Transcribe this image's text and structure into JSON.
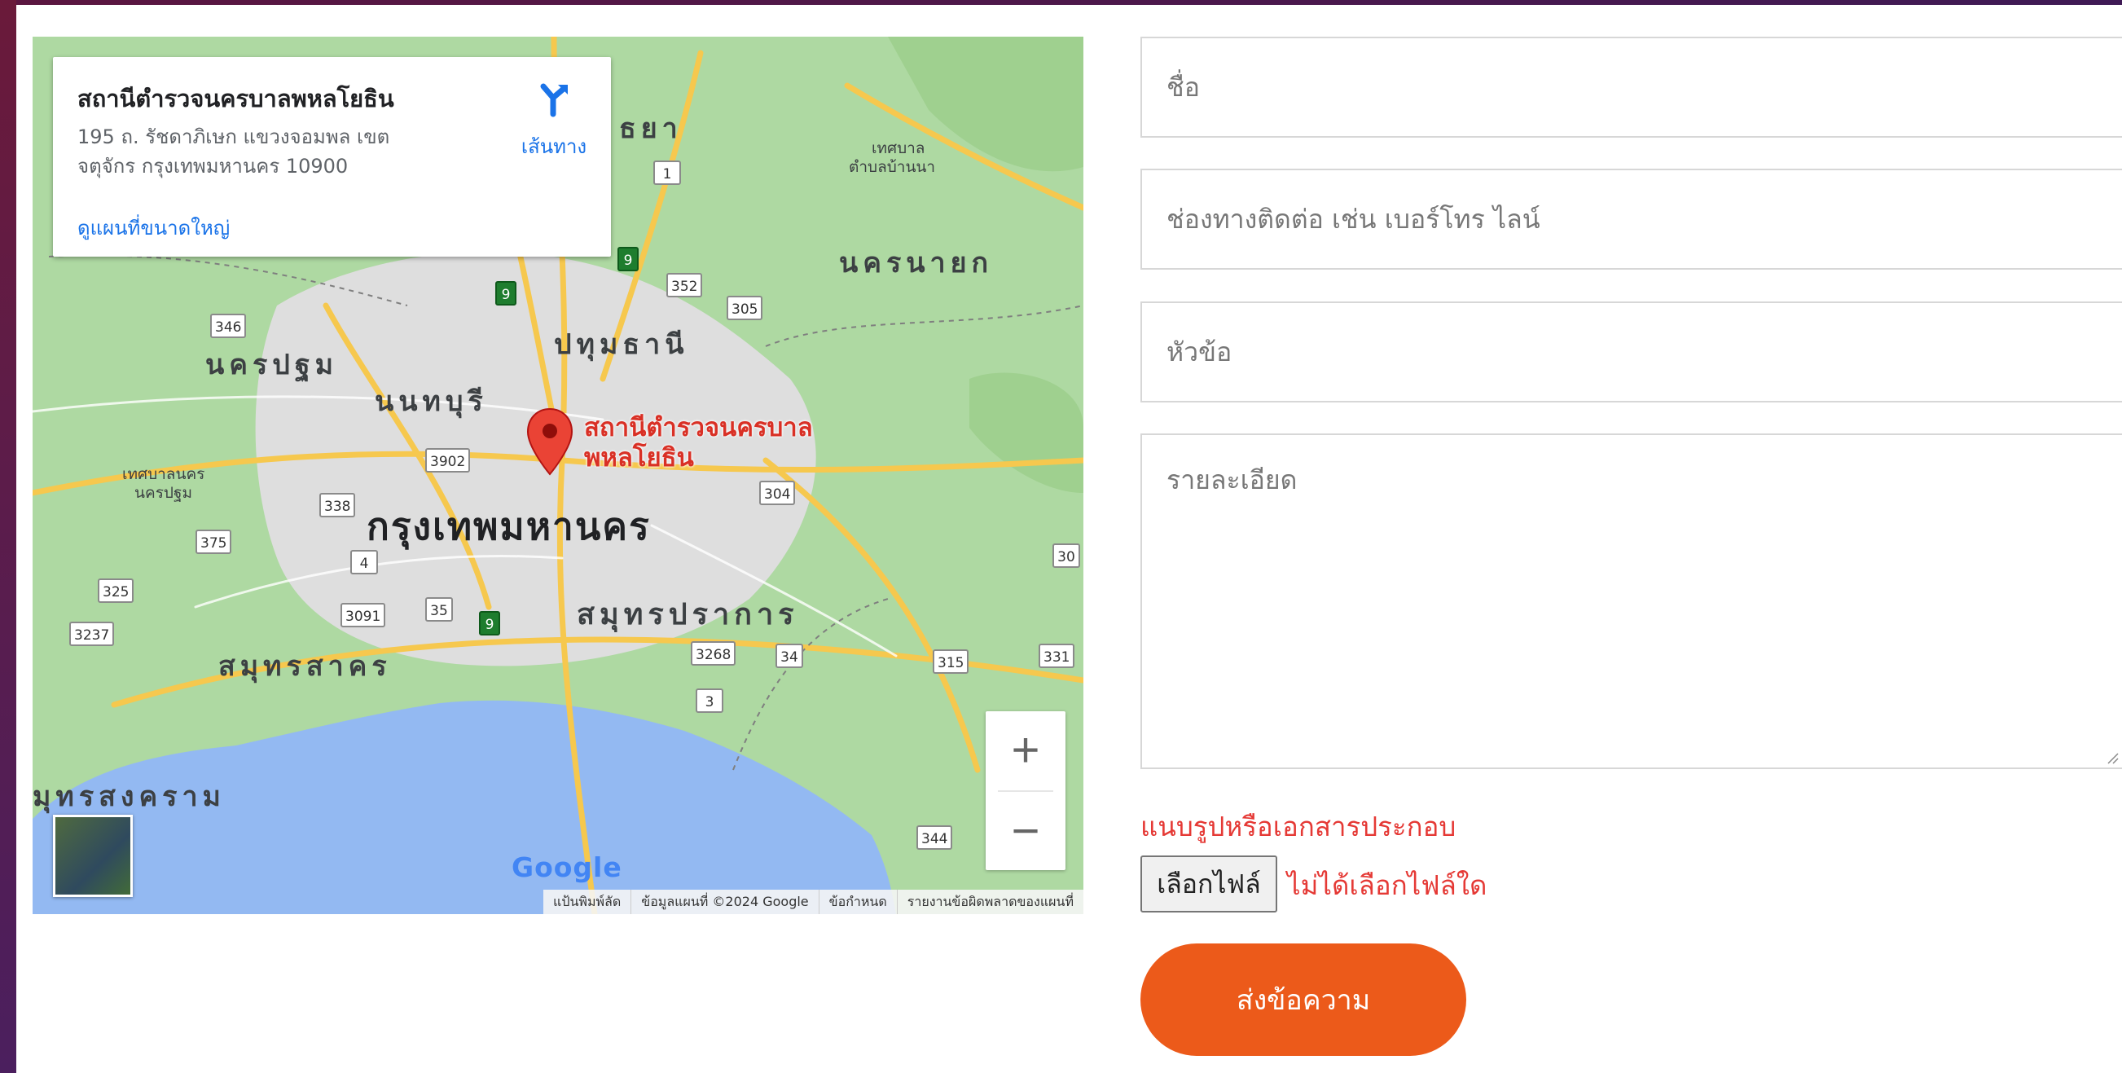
{
  "map": {
    "info_card": {
      "title": "สถานีตำรวจนครบาลพหลโยธิน",
      "address": "195 ถ. รัชดาภิเษก แขวงจอมพล เขตจตุจักร กรุงเทพมหานคร 10900",
      "view_larger": "ดูแผนที่ขนาดใหญ่",
      "directions_label": "เส้นทาง"
    },
    "pin_label_line1": "สถานีตำรวจนครบาล",
    "pin_label_line2": "พหลโยธิน",
    "places": {
      "bangkok": "กรุงเทพมหานคร",
      "pathum_thani": "ปทุมธานี",
      "nakhon_pathom": "นครปฐม",
      "nonthaburi": "นนทบุรี",
      "samut_prakan": "สมุทรปราการ",
      "samut_sakhon": "สมุทรสาคร",
      "samut_songkhram": "มุทรสงคราม",
      "nakhon_nayok": "นครนายก",
      "ayutthaya_partial": "ธยา",
      "municipality_nakhon_pathom_1": "เทศบาลนคร",
      "municipality_nakhon_pathom_2": "นครปฐม",
      "tambon_ban_na_1": "เทศบาล",
      "tambon_ban_na_2": "ตำบลบ้านนา"
    },
    "road_shields": {
      "r1": "1",
      "r9a": "9",
      "r9b": "9",
      "r9c": "9",
      "r352": "352",
      "r305": "305",
      "r346": "346",
      "r3902": "3902",
      "r338": "338",
      "r304": "304",
      "r375": "375",
      "r4": "4",
      "r325": "325",
      "r3091": "3091",
      "r35": "35",
      "r3237": "3237",
      "r3268": "3268",
      "r34": "34",
      "r3": "3",
      "r315": "315",
      "r331": "331",
      "r344": "344",
      "r30": "30"
    },
    "zoom_in": "+",
    "zoom_out": "−",
    "google_logo": "Google",
    "attribution": [
      "แป้นพิมพ์ลัด",
      "ข้อมูลแผนที่ ©2024 Google",
      "ข้อกำหนด",
      "รายงานข้อผิดพลาดของแผนที่"
    ]
  },
  "form": {
    "name_placeholder": "ชื่อ",
    "contact_placeholder": "ช่องทางติดต่อ เช่น เบอร์โทร ไลน์",
    "subject_placeholder": "หัวข้อ",
    "details_placeholder": "รายละเอียด",
    "attach_label": "แนบรูปหรือเอกสารประกอบ",
    "choose_file": "เลือกไฟล์",
    "no_file": "ไม่ได้เลือกไฟล์ใด",
    "submit": "ส่งข้อความ"
  },
  "colors": {
    "accent": "#ec5a1a",
    "error_text": "#e53935",
    "link": "#1a73e8",
    "pin": "#d93025"
  }
}
